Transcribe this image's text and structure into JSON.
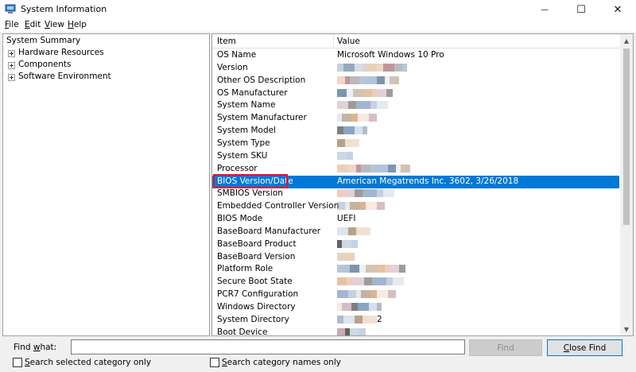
{
  "window": {
    "title": "System Information",
    "minimize_glyph": "—",
    "maximize_glyph": "☐",
    "close_glyph": "✕"
  },
  "menu": [
    {
      "key": "F",
      "rest": "ile"
    },
    {
      "key": "E",
      "rest": "dit"
    },
    {
      "key": "V",
      "rest": "iew"
    },
    {
      "key": "H",
      "rest": "elp"
    }
  ],
  "tree": {
    "root": "System Summary",
    "children": [
      "Hardware Resources",
      "Components",
      "Software Environment"
    ]
  },
  "list": {
    "headers": {
      "item": "Item",
      "value": "Value"
    },
    "rows": [
      {
        "item": "OS Name",
        "value": "Microsoft Windows 10 Pro"
      },
      {
        "item": "Version",
        "value": ""
      },
      {
        "item": "Other OS Description",
        "value": ""
      },
      {
        "item": "OS Manufacturer",
        "value": ""
      },
      {
        "item": "System Name",
        "value": ""
      },
      {
        "item": "System Manufacturer",
        "value": ""
      },
      {
        "item": "System Model",
        "value": ""
      },
      {
        "item": "System Type",
        "value": ""
      },
      {
        "item": "System SKU",
        "value": ""
      },
      {
        "item": "Processor",
        "value": ""
      },
      {
        "item": "BIOS Version/Date",
        "value": "American Megatrends Inc. 3602, 3/26/2018"
      },
      {
        "item": "SMBIOS Version",
        "value": ""
      },
      {
        "item": "Embedded Controller Version",
        "value": ""
      },
      {
        "item": "BIOS Mode",
        "value": "UEFI"
      },
      {
        "item": "BaseBoard Manufacturer",
        "value": ""
      },
      {
        "item": "BaseBoard Product",
        "value": ""
      },
      {
        "item": "BaseBoard Version",
        "value": ""
      },
      {
        "item": "Platform Role",
        "value": ""
      },
      {
        "item": "Secure Boot State",
        "value": ""
      },
      {
        "item": "PCR7 Configuration",
        "value": ""
      },
      {
        "item": "Windows Directory",
        "value": ""
      },
      {
        "item": "System Directory",
        "value": "2"
      },
      {
        "item": "Boot Device",
        "value": ""
      }
    ],
    "selected_item": "BIOS Version/Date"
  },
  "find": {
    "label_key": "w",
    "label_before": "Find ",
    "label_after": "hat:",
    "input_value": "",
    "find_button": "Find",
    "close_find_key": "C",
    "close_find_rest": "lose Find",
    "search_selected_key": "S",
    "search_selected_rest": "earch selected category only",
    "search_names_key": "S",
    "search_names_rest": "earch category names only"
  },
  "colors": {
    "selection": "#0078d7",
    "highlight_outline": "#e81123",
    "redaction_palette": [
      "#d4a373",
      "#8ba3c7",
      "#e8c2a8",
      "#5d7a9a",
      "#b07c8a",
      "#c9d6e3",
      "#3a3a3a",
      "#a6886b",
      "#6d8fb1"
    ]
  }
}
